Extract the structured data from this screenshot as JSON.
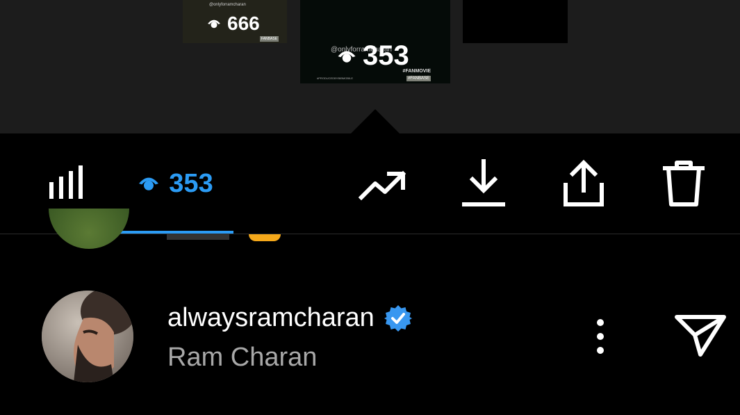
{
  "thumbnails": [
    {
      "handle": "@onlyforramcharan",
      "views": "666",
      "tag": "FANBASE"
    },
    {
      "handle": "@onlyforramcharan",
      "views": "353",
      "hashtag": "#FANMOVIE",
      "tag": "#FANBASE",
      "footer": "#PRODUCEDBYBIBMOBILE"
    }
  ],
  "toolbar": {
    "insights_icon": "bar-chart-icon",
    "views_count": "353",
    "views_icon": "eye-icon",
    "boost_icon": "trending-up-icon",
    "download_icon": "download-icon",
    "share_icon": "share-icon",
    "delete_icon": "trash-icon",
    "accent_color": "#2b9bf4"
  },
  "viewer": {
    "username": "alwaysramcharan",
    "verified": true,
    "full_name": "Ram Charan",
    "more_icon": "more-vertical-icon",
    "send_icon": "send-icon"
  }
}
